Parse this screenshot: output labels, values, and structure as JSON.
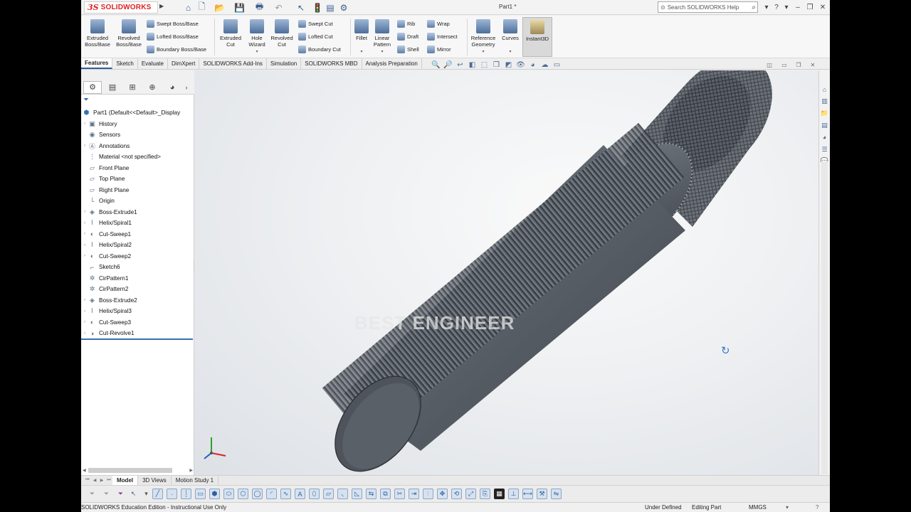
{
  "app": {
    "brand": "SOLIDWORKS",
    "brand_mark": "3S",
    "document_title": "Part1 *",
    "search_placeholder": "Search SOLIDWORKS Help"
  },
  "ribbon": {
    "extruded_boss": "Extruded Boss/Base",
    "revolved_boss": "Revolved Boss/Base",
    "swept_boss": "Swept Boss/Base",
    "lofted_boss": "Lofted Boss/Base",
    "boundary_boss": "Boundary Boss/Base",
    "extruded_cut": "Extruded Cut",
    "hole_wizard": "Hole Wizard",
    "revolved_cut": "Revolved Cut",
    "swept_cut": "Swept Cut",
    "lofted_cut": "Lofted Cut",
    "boundary_cut": "Boundary Cut",
    "fillet": "Fillet",
    "linear_pattern": "Linear Pattern",
    "rib": "Rib",
    "draft": "Draft",
    "shell": "Shell",
    "wrap": "Wrap",
    "intersect": "Intersect",
    "mirror": "Mirror",
    "reference_geometry": "Reference Geometry",
    "curves": "Curves",
    "instant3d": "Instant3D"
  },
  "command_tabs": [
    "Features",
    "Sketch",
    "Evaluate",
    "DimXpert",
    "SOLIDWORKS Add-Ins",
    "Simulation",
    "SOLIDWORKS MBD",
    "Analysis Preparation"
  ],
  "feature_tree": {
    "root": "Part1  (Default<<Default>_Display",
    "items": [
      "History",
      "Sensors",
      "Annotations",
      "Material <not specified>",
      "Front Plane",
      "Top Plane",
      "Right Plane",
      "Origin",
      "Boss-Extrude1",
      "Helix/Spiral1",
      "Cut-Sweep1",
      "Helix/Spiral2",
      "Cut-Sweep2",
      "Sketch6",
      "CirPattern1",
      "CirPattern2",
      "Boss-Extrude2",
      "Helix/Spiral3",
      "Cut-Sweep3",
      "Cut-Revolve1"
    ]
  },
  "viewport": {
    "watermark": "BEST ENGINEER"
  },
  "bottom_tabs": [
    "Model",
    "3D Views",
    "Motion Study 1"
  ],
  "status": {
    "edition": "SOLIDWORKS Education Edition - Instructional Use Only",
    "definition": "Under Defined",
    "mode": "Editing Part",
    "units": "MMGS"
  },
  "colors": {
    "brand_red": "#dd2222",
    "accent_blue": "#2d5f9a",
    "model_grey": "#5f656e"
  }
}
